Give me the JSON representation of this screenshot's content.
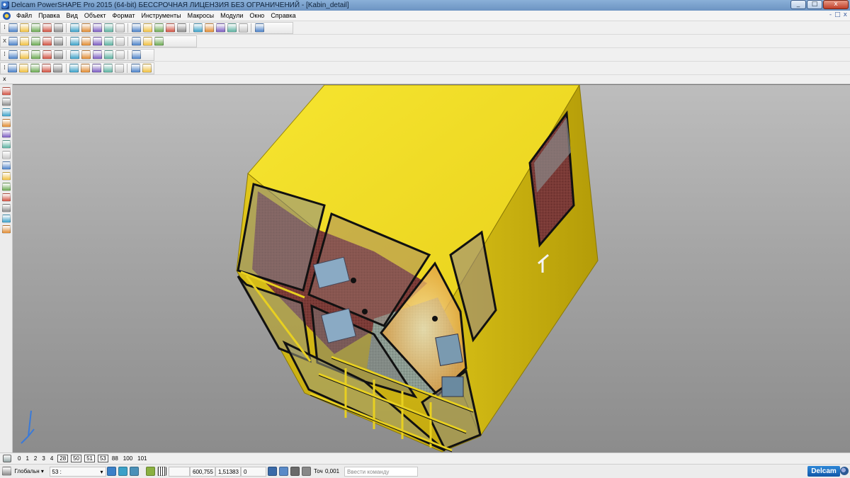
{
  "window": {
    "title": "Delcam PowerSHAPE Pro 2015 (64-bit) БЕССРОЧНАЯ ЛИЦЕНЗИЯ БЕЗ ОГРАНИЧЕНИЙ - [Kabin_detail]",
    "minimize": "_",
    "maximize": "□",
    "close": "x"
  },
  "menu": {
    "items": [
      "Файл",
      "Правка",
      "Вид",
      "Объект",
      "Формат",
      "Инструменты",
      "Макросы",
      "Модули",
      "Окно",
      "Справка"
    ],
    "mdi_minimize": "-",
    "mdi_restore": "□",
    "mdi_close": "x"
  },
  "toolbars": {
    "grip_close": "x",
    "grip_pin": "⁞",
    "row1_icons": [
      "new-file-icon",
      "open-file-icon",
      "open-model-icon",
      "save-icon",
      "print-icon",
      "cut-icon",
      "copy-icon",
      "paste-icon",
      "wand-icon",
      "undo-icon",
      "redo-icon",
      "refresh-icon",
      "select-icon",
      "axes-icon",
      "circle-icon",
      "curve-icon",
      "text-icon",
      "surface-icon",
      "solid-icon",
      "symbol-icon",
      "wireframe-icon"
    ],
    "row2_icons": [
      "view-top-icon",
      "view-front-icon",
      "view-iso-icon",
      "rotate-icon",
      "zoom-box-icon",
      "zoom-icon",
      "zoom-in-icon",
      "zoom-out-icon",
      "fit-icon",
      "shade-icon",
      "render-icon",
      "light-icon",
      "hand-icon"
    ],
    "row3_icons": [
      "level-icon",
      "layer-icon",
      "material-icon",
      "sphere-icon",
      "ball-icon",
      "cone-icon",
      "block-icon",
      "frame-icon",
      "display-icon",
      "group-icon",
      "mesh-icon"
    ],
    "row4_icons": [
      "solid-box-icon",
      "transform-icon",
      "move-icon",
      "edit-solid-icon",
      "feature-icon",
      "drill-icon",
      "part-icon",
      "assembly-icon",
      "analysis-icon",
      "draft-icon",
      "fillet-icon",
      "mirror-icon"
    ]
  },
  "left_toolbar": {
    "close": "x",
    "icons": [
      "cursor-icon",
      "coordinate-icon",
      "line-icon",
      "warning-icon",
      "arc-icon",
      "curve-edit-icon",
      "dimension-icon",
      "surface-tool-icon",
      "solid-tool-icon",
      "lathe-icon",
      "mesh-tool-icon",
      "analysis-tool-icon",
      "palette-icon",
      "feature-tool-icon"
    ]
  },
  "viewport": {
    "model_name": "Kabin_detail",
    "body_color": "#f1dc1e",
    "body_shade_color": "#c8b00c",
    "background_top": "#bdbdbd",
    "background_bottom": "#8c8c8c"
  },
  "levels": {
    "plain_before": [
      "0",
      "1",
      "2",
      "3",
      "4"
    ],
    "boxed": [
      "28",
      "50",
      "51",
      "53"
    ],
    "plain_after": [
      "88",
      "100",
      "101"
    ]
  },
  "status": {
    "workplane": "Глобальн",
    "level": "53",
    "level_suffix": ":",
    "x": "600,755",
    "y": "1,51383",
    "z": "0",
    "tolerance_label": "Точ",
    "tolerance": "0,001",
    "command_placeholder": "Ввести команду",
    "brand": "Delcam"
  }
}
